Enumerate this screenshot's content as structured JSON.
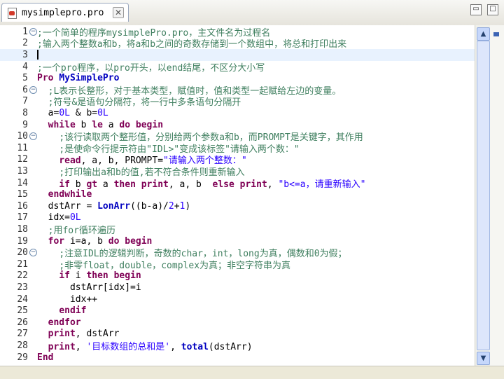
{
  "tab": {
    "title": "mysimplepro.pro",
    "close_symbol": "✕"
  },
  "window": {
    "minimize_symbol": "▭",
    "maximize_symbol": "□"
  },
  "scrollbar": {
    "up_symbol": "▲",
    "down_symbol": "▼"
  },
  "fold_symbol": "−",
  "lines": [
    {
      "n": "1",
      "fold": true,
      "parts": [
        {
          "c": "cm",
          "t": ";一个简单的程序mysimplePro.pro，主文件名为过程名"
        }
      ]
    },
    {
      "n": "2",
      "parts": [
        {
          "c": "cm",
          "t": ";输入两个整数a和b，将a和b之间的奇数存储到一个数组中，将总和打印出来"
        }
      ]
    },
    {
      "n": "3",
      "current": true,
      "parts": []
    },
    {
      "n": "4",
      "parts": [
        {
          "c": "cm",
          "t": ";一个pro程序，以pro开头，以end结尾，不区分大小写"
        }
      ]
    },
    {
      "n": "5",
      "parts": [
        {
          "c": "kw",
          "t": "Pro "
        },
        {
          "c": "fn",
          "t": "MySimplePro"
        }
      ]
    },
    {
      "n": "6",
      "fold": true,
      "parts": [
        {
          "c": "",
          "t": "  "
        },
        {
          "c": "cm",
          "t": ";L表示长整形，对于基本类型，赋值时，值和类型一起赋给左边的变量。"
        }
      ]
    },
    {
      "n": "7",
      "parts": [
        {
          "c": "",
          "t": "  "
        },
        {
          "c": "cm",
          "t": ";符号&是语句分隔符，将一行中多条语句分隔开"
        }
      ]
    },
    {
      "n": "8",
      "parts": [
        {
          "c": "",
          "t": "  a="
        },
        {
          "c": "num",
          "t": "0L"
        },
        {
          "c": "",
          "t": " & b="
        },
        {
          "c": "num",
          "t": "0L"
        }
      ]
    },
    {
      "n": "9",
      "parts": [
        {
          "c": "",
          "t": "  "
        },
        {
          "c": "kw",
          "t": "while"
        },
        {
          "c": "",
          "t": " b "
        },
        {
          "c": "kw",
          "t": "le"
        },
        {
          "c": "",
          "t": " a "
        },
        {
          "c": "kw",
          "t": "do begin"
        }
      ]
    },
    {
      "n": "10",
      "fold": true,
      "parts": [
        {
          "c": "",
          "t": "    "
        },
        {
          "c": "cm",
          "t": ";该行读取两个整形值，分别给两个参数a和b，而PROMPT是关键字，其作用"
        }
      ]
    },
    {
      "n": "11",
      "parts": [
        {
          "c": "",
          "t": "    "
        },
        {
          "c": "cm",
          "t": ";是使命令行提示符由\"IDL>\"变成该标签\"请输入两个数：\""
        }
      ]
    },
    {
      "n": "12",
      "parts": [
        {
          "c": "",
          "t": "    "
        },
        {
          "c": "kw",
          "t": "read"
        },
        {
          "c": "",
          "t": ", a, b, PROMPT="
        },
        {
          "c": "str",
          "t": "\"请输入两个整数：\""
        }
      ]
    },
    {
      "n": "13",
      "parts": [
        {
          "c": "",
          "t": "    "
        },
        {
          "c": "cm",
          "t": ";打印输出a和b的值,若不符合条件则重新输入"
        }
      ]
    },
    {
      "n": "14",
      "parts": [
        {
          "c": "",
          "t": "    "
        },
        {
          "c": "kw",
          "t": "if"
        },
        {
          "c": "",
          "t": " b "
        },
        {
          "c": "kw",
          "t": "gt"
        },
        {
          "c": "",
          "t": " a "
        },
        {
          "c": "kw",
          "t": "then print"
        },
        {
          "c": "",
          "t": ", a, b  "
        },
        {
          "c": "kw",
          "t": "else print"
        },
        {
          "c": "",
          "t": ", "
        },
        {
          "c": "str",
          "t": "\"b<=a，请重新输入\""
        }
      ]
    },
    {
      "n": "15",
      "parts": [
        {
          "c": "",
          "t": "  "
        },
        {
          "c": "kw",
          "t": "endwhile"
        }
      ]
    },
    {
      "n": "16",
      "parts": [
        {
          "c": "",
          "t": "  dstArr = "
        },
        {
          "c": "fn",
          "t": "LonArr"
        },
        {
          "c": "",
          "t": "((b-a)/"
        },
        {
          "c": "num",
          "t": "2"
        },
        {
          "c": "",
          "t": "+"
        },
        {
          "c": "num",
          "t": "1"
        },
        {
          "c": "",
          "t": ")"
        }
      ]
    },
    {
      "n": "17",
      "parts": [
        {
          "c": "",
          "t": "  idx="
        },
        {
          "c": "num",
          "t": "0L"
        }
      ]
    },
    {
      "n": "18",
      "parts": [
        {
          "c": "",
          "t": "  "
        },
        {
          "c": "cm",
          "t": ";用for循环遍历"
        }
      ]
    },
    {
      "n": "19",
      "parts": [
        {
          "c": "",
          "t": "  "
        },
        {
          "c": "kw",
          "t": "for"
        },
        {
          "c": "",
          "t": " i=a, b "
        },
        {
          "c": "kw",
          "t": "do begin"
        }
      ]
    },
    {
      "n": "20",
      "fold": true,
      "parts": [
        {
          "c": "",
          "t": "    "
        },
        {
          "c": "cm",
          "t": ";注意IDL的逻辑判断，奇数的char，int，long为真，偶数和0为假；"
        }
      ]
    },
    {
      "n": "21",
      "parts": [
        {
          "c": "",
          "t": "    "
        },
        {
          "c": "cm",
          "t": ";非零float，double，complex为真；非空字符串为真"
        }
      ]
    },
    {
      "n": "22",
      "parts": [
        {
          "c": "",
          "t": "    "
        },
        {
          "c": "kw",
          "t": "if"
        },
        {
          "c": "",
          "t": " i "
        },
        {
          "c": "kw",
          "t": "then begin"
        }
      ]
    },
    {
      "n": "23",
      "parts": [
        {
          "c": "",
          "t": "      dstArr[idx]=i"
        }
      ]
    },
    {
      "n": "24",
      "parts": [
        {
          "c": "",
          "t": "      idx++"
        }
      ]
    },
    {
      "n": "25",
      "parts": [
        {
          "c": "",
          "t": "    "
        },
        {
          "c": "kw",
          "t": "endif"
        }
      ]
    },
    {
      "n": "26",
      "parts": [
        {
          "c": "",
          "t": "  "
        },
        {
          "c": "kw",
          "t": "endfor"
        }
      ]
    },
    {
      "n": "27",
      "parts": [
        {
          "c": "",
          "t": "  "
        },
        {
          "c": "kw",
          "t": "print"
        },
        {
          "c": "",
          "t": ", dstArr"
        }
      ]
    },
    {
      "n": "28",
      "parts": [
        {
          "c": "",
          "t": "  "
        },
        {
          "c": "kw",
          "t": "print"
        },
        {
          "c": "",
          "t": ", "
        },
        {
          "c": "str",
          "t": "'目标数组的总和是'"
        },
        {
          "c": "",
          "t": ", "
        },
        {
          "c": "fn",
          "t": "total"
        },
        {
          "c": "",
          "t": "(dstArr)"
        }
      ]
    },
    {
      "n": "29",
      "parts": [
        {
          "c": "kw",
          "t": "End"
        }
      ]
    }
  ]
}
